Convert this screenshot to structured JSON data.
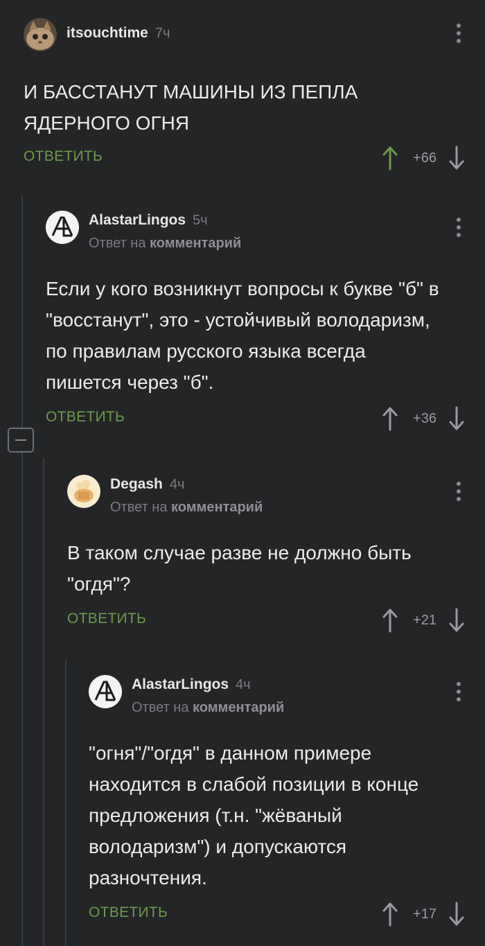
{
  "comments": [
    {
      "author": "itsouchtime",
      "time": "7ч",
      "text": "И БАССТАНУТ МАШИНЫ ИЗ ПЕПЛА ЯДЕРНОГО ОГНЯ",
      "reply_label": "ОТВЕТИТЬ",
      "score": "+66",
      "upvote_color": "#6e9a4b"
    },
    {
      "author": "AlastarLingos",
      "time": "5ч",
      "reply_prefix": "Ответ на",
      "reply_target": "комментарий",
      "text": "Если у кого возникнут вопросы к букве \"б\" в \"восстанут\", это - устойчивый володаризм, по правилам русского языка всегда пишется через \"б\".",
      "reply_label": "ОТВЕТИТЬ",
      "score": "+36"
    },
    {
      "author": "Degash",
      "time": "4ч",
      "reply_prefix": "Ответ на",
      "reply_target": "комментарий",
      "text": "В таком случае разве не должно быть \"огдя\"?",
      "reply_label": "ОТВЕТИТЬ",
      "score": "+21"
    },
    {
      "author": "AlastarLingos",
      "time": "4ч",
      "reply_prefix": "Ответ на",
      "reply_target": "комментарий",
      "text": "\"огня\"/\"огдя\" в данном примере находится в слабой позиции в конце предложения (т.н. \"жёваный володаризм\") и допускаются разночтения.",
      "reply_label": "ОТВЕТИТЬ",
      "score": "+17"
    }
  ],
  "icons": {
    "upvote": "arrow-up-icon",
    "downvote": "arrow-down-icon",
    "menu": "more-vertical-icon",
    "collapse": "minus-icon"
  },
  "colors": {
    "background": "#232527",
    "accent_green": "#6e9a4b",
    "muted": "#7a7c7f"
  }
}
